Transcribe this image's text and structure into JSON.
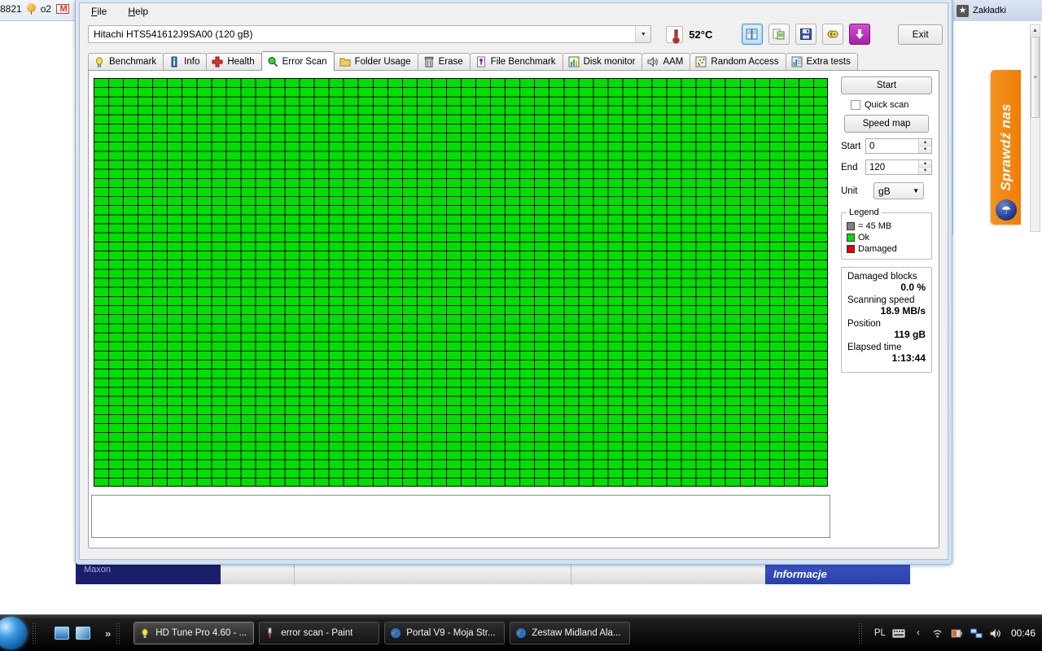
{
  "background": {
    "left_items": [
      "8821",
      "o2"
    ],
    "balloon_icon": "balloon-icon",
    "gmail_icon": "gmail-icon",
    "bookmarks_label": "Zakładki",
    "star_icon": "star-icon",
    "promo_tab_text": "Sprawdź nas",
    "umbrella_icon": "umbrella-icon",
    "maxon_label": "Maxon",
    "info_label": "Informacje"
  },
  "window": {
    "menu": [
      {
        "label": "File",
        "accel": "F"
      },
      {
        "label": "Help",
        "accel": "H"
      }
    ],
    "drive": {
      "selected": "Hitachi HTS541612J9SA00 (120 gB)",
      "dropdown_icon": "chevron-down-icon"
    },
    "temperature": {
      "value": "52°C",
      "icon": "thermometer-icon"
    },
    "toolbar": [
      {
        "name": "copy-report-icon",
        "glyph": "▤",
        "active": true
      },
      {
        "name": "export-document-icon",
        "glyph": "▤",
        "active": false
      },
      {
        "name": "save-icon",
        "glyph": "▤",
        "active": false
      },
      {
        "name": "settings-icon",
        "glyph": "▤",
        "active": false
      },
      {
        "name": "download-icon",
        "glyph": "↓",
        "active": false
      }
    ],
    "exit_label": "Exit",
    "tabs": [
      {
        "label": "Benchmark",
        "icon": "lightbulb-icon",
        "selected": false
      },
      {
        "label": "Info",
        "icon": "info-icon",
        "selected": false
      },
      {
        "label": "Health",
        "icon": "red-cross-icon",
        "selected": false
      },
      {
        "label": "Error Scan",
        "icon": "magnifier-icon",
        "selected": true
      },
      {
        "label": "Folder Usage",
        "icon": "folder-icon",
        "selected": false
      },
      {
        "label": "Erase",
        "icon": "trash-icon",
        "selected": false
      },
      {
        "label": "File Benchmark",
        "icon": "file-icon",
        "selected": false
      },
      {
        "label": "Disk monitor",
        "icon": "bar-chart-icon",
        "selected": false
      },
      {
        "label": "AAM",
        "icon": "speaker-icon",
        "selected": false
      },
      {
        "label": "Random Access",
        "icon": "scatter-icon",
        "selected": false
      },
      {
        "label": "Extra tests",
        "icon": "grid-chart-icon",
        "selected": false
      }
    ]
  },
  "controls": {
    "start_label": "Start",
    "quick_scan_label": "Quick scan",
    "quick_scan_checked": false,
    "speed_map_label": "Speed map",
    "start_field": {
      "label": "Start",
      "value": "0"
    },
    "end_field": {
      "label": "End",
      "value": "120"
    },
    "unit_field": {
      "label": "Unit",
      "value": "gB",
      "dropdown_icon": "chevron-down-icon"
    }
  },
  "legend": {
    "title": "Legend",
    "items": [
      {
        "label": "= 45 MB",
        "color": "#808080"
      },
      {
        "label": "Ok",
        "color": "#00e000"
      },
      {
        "label": "Damaged",
        "color": "#e00000"
      }
    ]
  },
  "stats": [
    {
      "label": "Damaged blocks",
      "value": "0.0 %"
    },
    {
      "label": "Scanning speed",
      "value": "18.9 MB/s"
    },
    {
      "label": "Position",
      "value": "119 gB"
    },
    {
      "label": "Elapsed time",
      "value": "1:13:44"
    }
  ],
  "scan_grid": {
    "status": "ok",
    "block_color": "#00e000",
    "gridline_color": "#000000",
    "columns": 50,
    "rows": 45
  },
  "log": {
    "text": ""
  },
  "taskbar": {
    "start_icon": "windows-start-orb-icon",
    "quick_launch": [
      {
        "name": "show-desktop-icon"
      },
      {
        "name": "switch-window-icon"
      }
    ],
    "overflow_icon": "chevron-double-right-icon",
    "tasks": [
      {
        "label": "HD Tune Pro 4.60 - ...",
        "icon": "hdtune-icon",
        "active": true
      },
      {
        "label": "error scan - Paint",
        "icon": "paint-icon",
        "active": false
      },
      {
        "label": "Portal V9 - Moja Str...",
        "icon": "firefox-icon",
        "active": false
      },
      {
        "label": "Zestaw Midland Ala...",
        "icon": "firefox-icon",
        "active": false
      }
    ],
    "tray": {
      "language": "PL",
      "icons": [
        "keyboard-icon",
        "chevron-left-icon",
        "wifi-icon",
        "battery-icon",
        "network-icon",
        "volume-icon"
      ],
      "clock": "00:46"
    }
  }
}
